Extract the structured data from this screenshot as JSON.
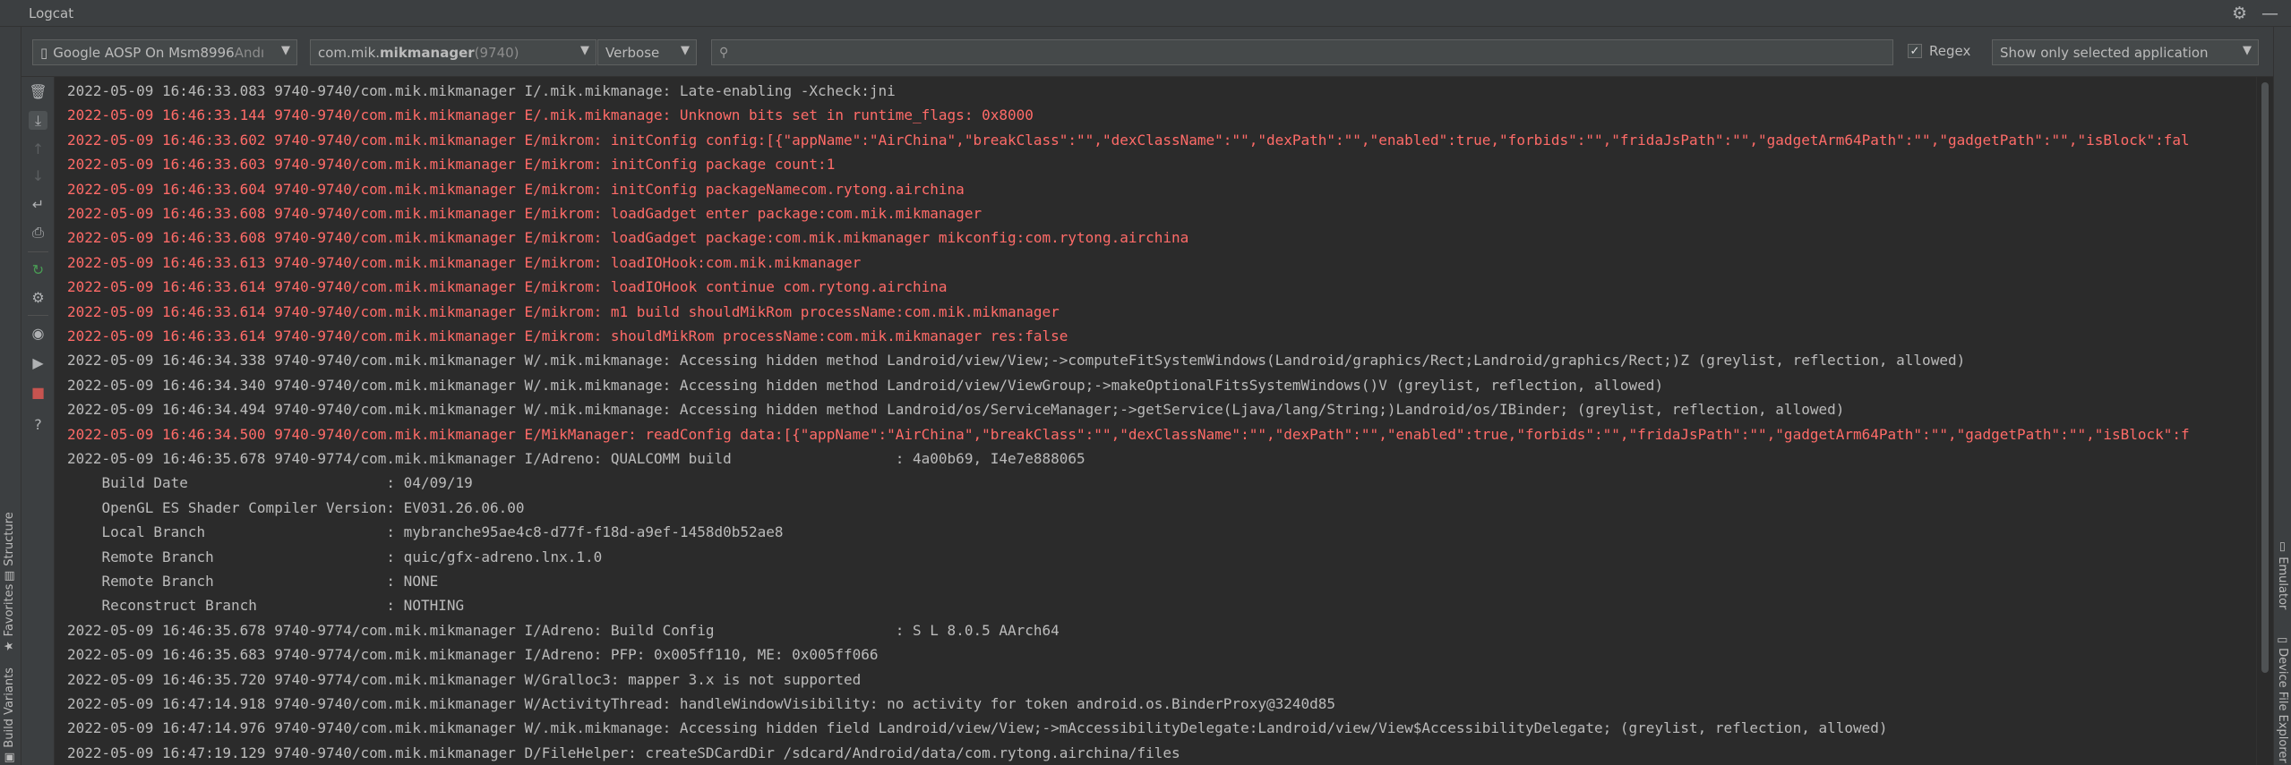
{
  "window": {
    "title": "Logcat"
  },
  "titlebar_icons": [
    {
      "name": "gear-icon",
      "glyph": "⚙"
    },
    {
      "name": "minimize-icon",
      "glyph": "—"
    }
  ],
  "filters": {
    "device": {
      "text": "Google AOSP On Msm8996 ",
      "suffix": "Andı",
      "icon": "phone-icon"
    },
    "process": {
      "prefix": "com.mik.",
      "bold": "mikmanager",
      "pid": " (9740)"
    },
    "level": {
      "value": "Verbose"
    },
    "search": {
      "value": "",
      "placeholder": ""
    },
    "regex": {
      "label": "Regex",
      "checked": true
    },
    "scope": {
      "value": "Show only selected application"
    }
  },
  "left_strip_tabs": [
    {
      "label": "Structure",
      "icon": "structure-icon"
    },
    {
      "label": "Favorites",
      "icon": "star-icon"
    },
    {
      "label": "Build Variants",
      "icon": "build-variants-icon"
    }
  ],
  "right_strip_tabs": [
    {
      "label": "Emulator",
      "icon": "emulator-icon"
    },
    {
      "label": "Device File Explorer",
      "icon": "device-file-icon"
    }
  ],
  "toolbar": [
    {
      "name": "clear-logcat-icon",
      "glyph": "🗑",
      "state": ""
    },
    {
      "name": "scroll-to-end-icon",
      "glyph": "⤓",
      "state": "active"
    },
    {
      "name": "up-icon",
      "glyph": "↑",
      "state": "disabled"
    },
    {
      "name": "down-icon",
      "glyph": "↓",
      "state": "disabled"
    },
    {
      "name": "soft-wrap-icon",
      "glyph": "↵",
      "state": ""
    },
    {
      "name": "print-icon",
      "glyph": "⎙",
      "state": ""
    },
    {
      "name": "restart-icon",
      "glyph": "↻",
      "state": "green"
    },
    {
      "name": "settings-icon",
      "glyph": "⚙",
      "state": ""
    },
    {
      "name": "screenshot-icon",
      "glyph": "◉",
      "state": ""
    },
    {
      "name": "screen-record-icon",
      "glyph": "▶",
      "state": ""
    },
    {
      "name": "stop-icon",
      "glyph": "■",
      "state": "red"
    },
    {
      "name": "help-icon",
      "glyph": "?",
      "state": ""
    }
  ],
  "log_lines": [
    {
      "level": "I",
      "text": "2022-05-09 16:46:33.083 9740-9740/com.mik.mikmanager I/.mik.mikmanage: Late-enabling -Xcheck:jni"
    },
    {
      "level": "E",
      "text": "2022-05-09 16:46:33.144 9740-9740/com.mik.mikmanager E/.mik.mikmanage: Unknown bits set in runtime_flags: 0x8000"
    },
    {
      "level": "E",
      "text": "2022-05-09 16:46:33.602 9740-9740/com.mik.mikmanager E/mikrom: initConfig config:[{\"appName\":\"AirChina\",\"breakClass\":\"\",\"dexClassName\":\"\",\"dexPath\":\"\",\"enabled\":true,\"forbids\":\"\",\"fridaJsPath\":\"\",\"gadgetArm64Path\":\"\",\"gadgetPath\":\"\",\"isBlock\":fal"
    },
    {
      "level": "E",
      "text": "2022-05-09 16:46:33.603 9740-9740/com.mik.mikmanager E/mikrom: initConfig package count:1"
    },
    {
      "level": "E",
      "text": "2022-05-09 16:46:33.604 9740-9740/com.mik.mikmanager E/mikrom: initConfig packageNamecom.rytong.airchina"
    },
    {
      "level": "E",
      "text": "2022-05-09 16:46:33.608 9740-9740/com.mik.mikmanager E/mikrom: loadGadget enter package:com.mik.mikmanager"
    },
    {
      "level": "E",
      "text": "2022-05-09 16:46:33.608 9740-9740/com.mik.mikmanager E/mikrom: loadGadget package:com.mik.mikmanager mikconfig:com.rytong.airchina"
    },
    {
      "level": "E",
      "text": "2022-05-09 16:46:33.613 9740-9740/com.mik.mikmanager E/mikrom: loadIOHook:com.mik.mikmanager"
    },
    {
      "level": "E",
      "text": "2022-05-09 16:46:33.614 9740-9740/com.mik.mikmanager E/mikrom: loadIOHook continue com.rytong.airchina"
    },
    {
      "level": "E",
      "text": "2022-05-09 16:46:33.614 9740-9740/com.mik.mikmanager E/mikrom: m1 build shouldMikRom processName:com.mik.mikmanager"
    },
    {
      "level": "E",
      "text": "2022-05-09 16:46:33.614 9740-9740/com.mik.mikmanager E/mikrom: shouldMikRom processName:com.mik.mikmanager res:false"
    },
    {
      "level": "W",
      "text": "2022-05-09 16:46:34.338 9740-9740/com.mik.mikmanager W/.mik.mikmanage: Accessing hidden method Landroid/view/View;->computeFitSystemWindows(Landroid/graphics/Rect;Landroid/graphics/Rect;)Z (greylist, reflection, allowed)"
    },
    {
      "level": "W",
      "text": "2022-05-09 16:46:34.340 9740-9740/com.mik.mikmanager W/.mik.mikmanage: Accessing hidden method Landroid/view/ViewGroup;->makeOptionalFitsSystemWindows()V (greylist, reflection, allowed)"
    },
    {
      "level": "W",
      "text": "2022-05-09 16:46:34.494 9740-9740/com.mik.mikmanager W/.mik.mikmanage: Accessing hidden method Landroid/os/ServiceManager;->getService(Ljava/lang/String;)Landroid/os/IBinder; (greylist, reflection, allowed)"
    },
    {
      "level": "E",
      "text": "2022-05-09 16:46:34.500 9740-9740/com.mik.mikmanager E/MikManager: readConfig data:[{\"appName\":\"AirChina\",\"breakClass\":\"\",\"dexClassName\":\"\",\"dexPath\":\"\",\"enabled\":true,\"forbids\":\"\",\"fridaJsPath\":\"\",\"gadgetArm64Path\":\"\",\"gadgetPath\":\"\",\"isBlock\":f"
    },
    {
      "level": "I",
      "text": "2022-05-09 16:46:35.678 9740-9774/com.mik.mikmanager I/Adreno: QUALCOMM build                   : 4a00b69, I4e7e888065"
    },
    {
      "level": "I",
      "text": "    Build Date                       : 04/09/19"
    },
    {
      "level": "I",
      "text": "    OpenGL ES Shader Compiler Version: EV031.26.06.00"
    },
    {
      "level": "I",
      "text": "    Local Branch                     : mybranche95ae4c8-d77f-f18d-a9ef-1458d0b52ae8"
    },
    {
      "level": "I",
      "text": "    Remote Branch                    : quic/gfx-adreno.lnx.1.0"
    },
    {
      "level": "I",
      "text": "    Remote Branch                    : NONE"
    },
    {
      "level": "I",
      "text": "    Reconstruct Branch               : NOTHING"
    },
    {
      "level": "I",
      "text": "2022-05-09 16:46:35.678 9740-9774/com.mik.mikmanager I/Adreno: Build Config                     : S L 8.0.5 AArch64"
    },
    {
      "level": "I",
      "text": "2022-05-09 16:46:35.683 9740-9774/com.mik.mikmanager I/Adreno: PFP: 0x005ff110, ME: 0x005ff066"
    },
    {
      "level": "W",
      "text": "2022-05-09 16:46:35.720 9740-9774/com.mik.mikmanager W/Gralloc3: mapper 3.x is not supported"
    },
    {
      "level": "W",
      "text": "2022-05-09 16:47:14.918 9740-9740/com.mik.mikmanager W/ActivityThread: handleWindowVisibility: no activity for token android.os.BinderProxy@3240d85"
    },
    {
      "level": "W",
      "text": "2022-05-09 16:47:14.976 9740-9740/com.mik.mikmanager W/.mik.mikmanage: Accessing hidden field Landroid/view/View;->mAccessibilityDelegate:Landroid/view/View$AccessibilityDelegate; (greylist, reflection, allowed)"
    },
    {
      "level": "D",
      "text": "2022-05-09 16:47:19.129 9740-9740/com.mik.mikmanager D/FileHelper: createSDCardDir /sdcard/Android/data/com.rytong.airchina/files"
    }
  ],
  "colors": {
    "error": "#ff6b68",
    "info": "#bbbbbb",
    "background": "#2b2b2b",
    "panel": "#3c3f41"
  }
}
